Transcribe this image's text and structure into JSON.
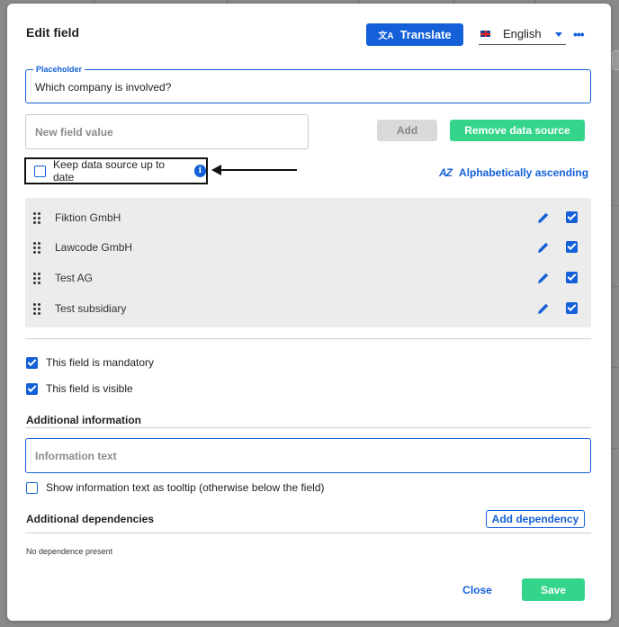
{
  "modal": {
    "title": "Edit field",
    "translate_label": "Translate",
    "language": "English",
    "more_icon": "more-dots-icon"
  },
  "placeholder_field": {
    "label": "Placeholder",
    "value": "Which company is involved?"
  },
  "data_source": {
    "new_value_placeholder": "New field value",
    "add_label": "Add",
    "remove_label": "Remove data source",
    "keep_up_to_date_label": "Keep data source up to date",
    "keep_up_to_date_checked": false,
    "sort_label": "Alphabetically ascending",
    "values": [
      {
        "label": "Fiktion GmbH",
        "checked": true
      },
      {
        "label": "Lawcode GmbH",
        "checked": true
      },
      {
        "label": "Test AG",
        "checked": true
      },
      {
        "label": "Test subsidiary",
        "checked": true
      }
    ]
  },
  "options": {
    "mandatory_label": "This field is mandatory",
    "mandatory_checked": true,
    "visible_label": "This field is visible",
    "visible_checked": true
  },
  "additional_information": {
    "title": "Additional information",
    "placeholder": "Information text",
    "tooltip_label": "Show information text as tooltip (otherwise below the field)",
    "tooltip_checked": false
  },
  "dependencies": {
    "title": "Additional dependencies",
    "add_label": "Add dependency",
    "empty_text": "No dependence present"
  },
  "footer": {
    "close_label": "Close",
    "save_label": "Save"
  },
  "colors": {
    "primary": "#1360d8",
    "success": "#34d58b",
    "disabled": "#d9d9d9",
    "panel": "#ececec"
  }
}
